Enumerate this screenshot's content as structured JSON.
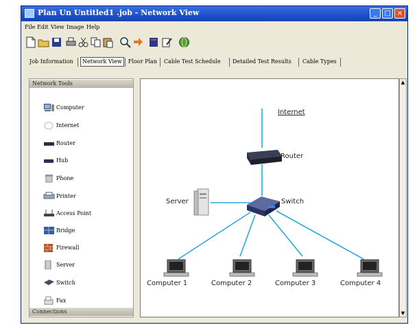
{
  "window": {
    "title": "Plan Un Untitled1 .job - Network View"
  },
  "menubar": {
    "items": [
      "File",
      "Edit",
      "View",
      "Image",
      "Help"
    ]
  },
  "toolbar": {
    "icons": [
      "new-icon",
      "open-icon",
      "save-icon",
      "print-icon",
      "cut-icon",
      "copy-icon",
      "paste-icon",
      "zoom-icon",
      "arrow-icon",
      "book-icon",
      "edit-icon",
      "globe-icon"
    ]
  },
  "tabs": {
    "items": [
      "Job Information",
      "Network View",
      "Floor Plan",
      "Cable Test Schedule",
      "Detailed Test Results",
      "Cable Types"
    ],
    "active": "Network View"
  },
  "network_tools": {
    "header": "Network Tools",
    "footer": "Connections",
    "items": [
      {
        "label": "Computer",
        "icon": "computer-icon"
      },
      {
        "label": "Internet",
        "icon": "internet-icon"
      },
      {
        "label": "Router",
        "icon": "router-icon"
      },
      {
        "label": "Hub",
        "icon": "hub-icon"
      },
      {
        "label": "Phone",
        "icon": "phone-icon"
      },
      {
        "label": "Printer",
        "icon": "printer-icon"
      },
      {
        "label": "Access Point",
        "icon": "access-point-icon"
      },
      {
        "label": "Bridge",
        "icon": "bridge-icon"
      },
      {
        "label": "Firewall",
        "icon": "firewall-icon"
      },
      {
        "label": "Server",
        "icon": "server-icon"
      },
      {
        "label": "Switch",
        "icon": "switch-icon"
      },
      {
        "label": "Fax",
        "icon": "fax-icon"
      }
    ]
  },
  "diagram": {
    "nodes": {
      "internet": "Internet",
      "router": "Router",
      "server": "Server",
      "switch": "Switch",
      "computer1": "Computer 1",
      "computer2": "Computer 2",
      "computer3": "Computer 3",
      "computer4": "Computer 4"
    },
    "link_color": "#29a8e0"
  }
}
